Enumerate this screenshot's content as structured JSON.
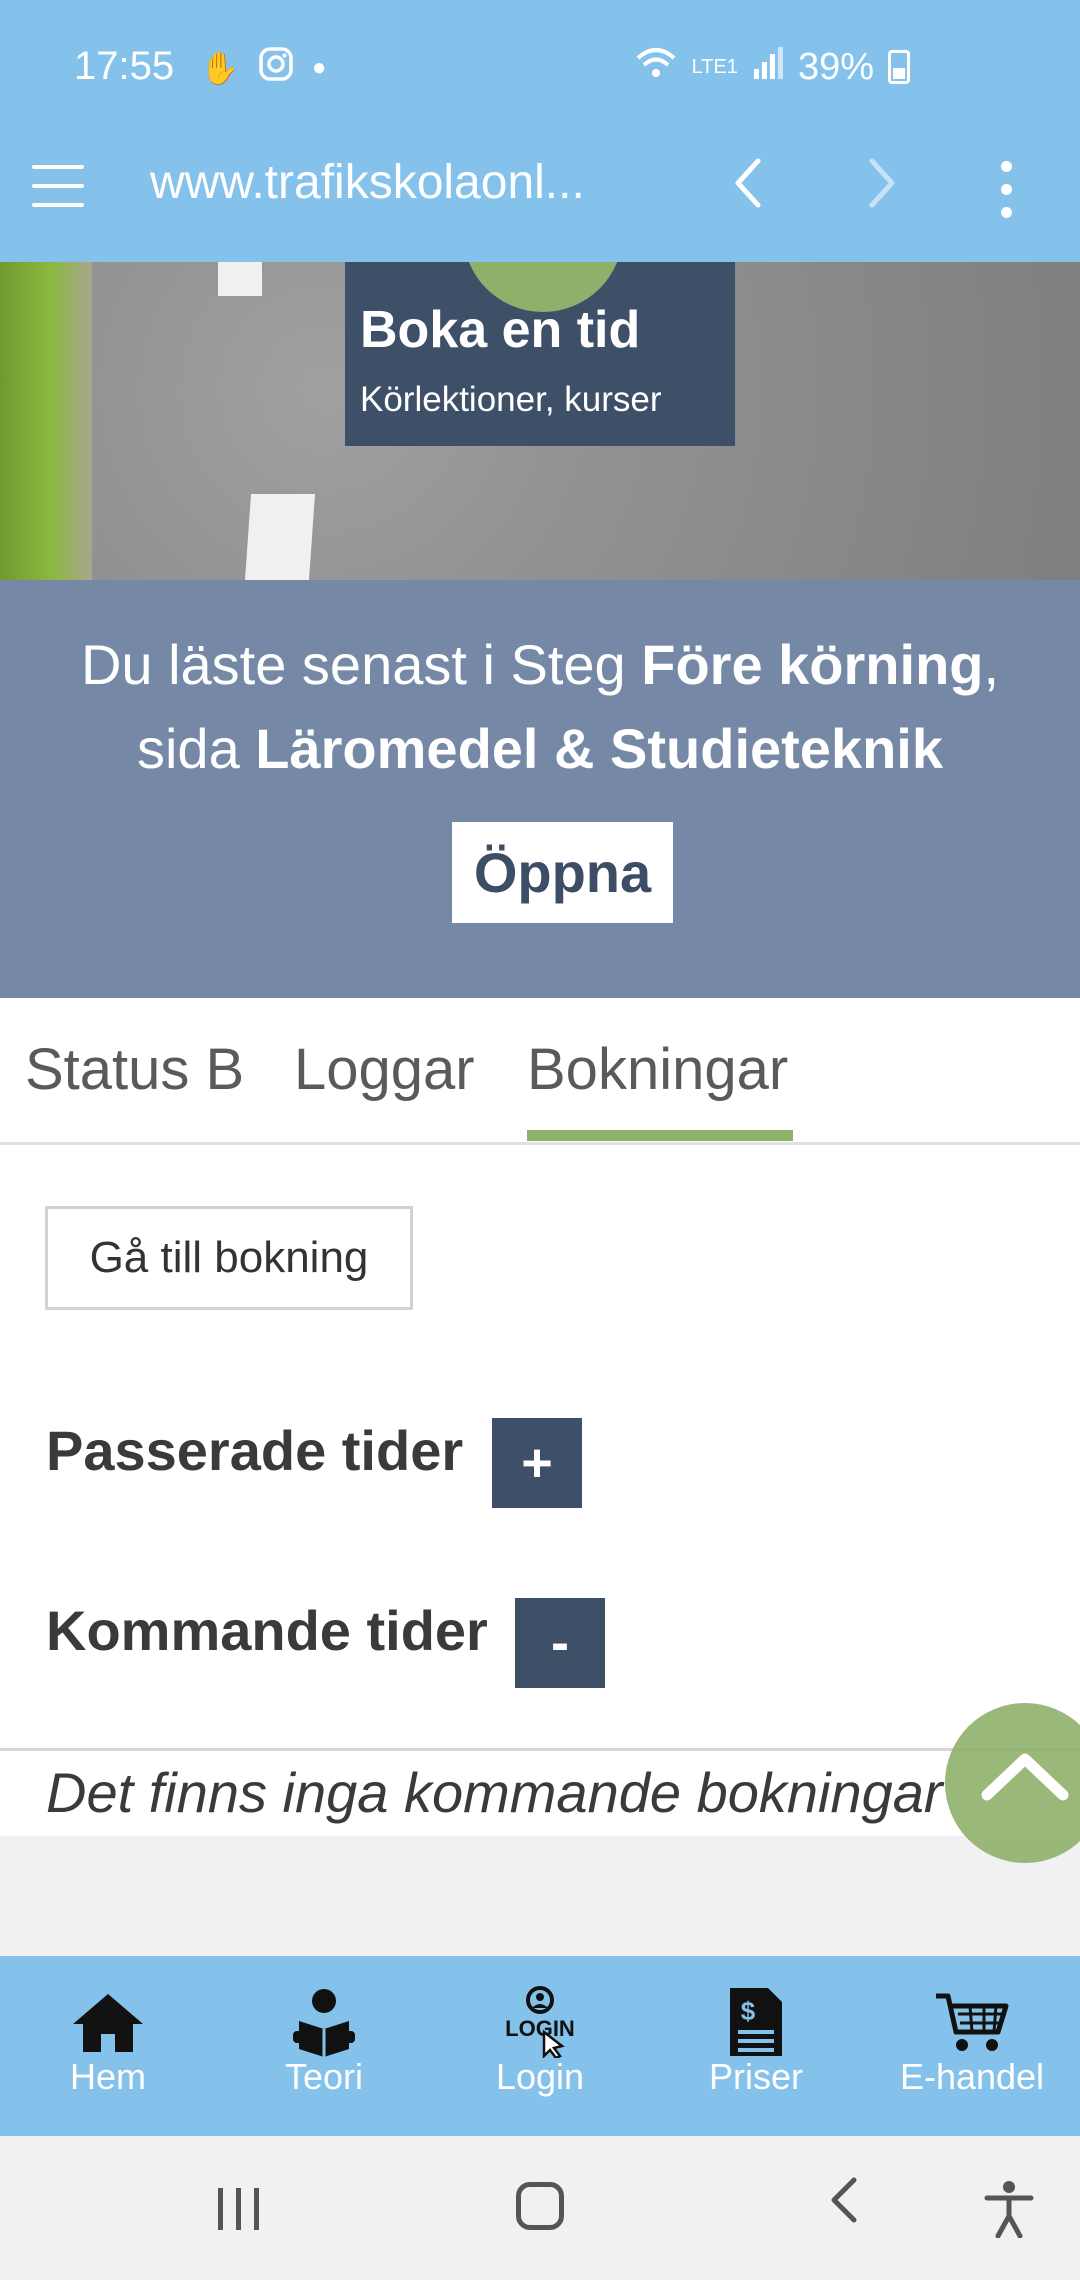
{
  "status_bar": {
    "time": "17:55",
    "battery": "39%",
    "network": "LTE1"
  },
  "browser": {
    "url": "www.trafikskolaonl...",
    "back_glyph": "‹",
    "forward_glyph": "›"
  },
  "hero": {
    "title": "Boka en tid",
    "subtitle": "Körlektioner, kurser"
  },
  "last_read": {
    "prefix": "Du läste senast i Steg ",
    "step": "Före körning",
    "comma": ",",
    "page_prefix": "sida ",
    "page": "Läromedel & Studieteknik",
    "open_label": "Öppna"
  },
  "tabs": [
    {
      "label": "Status B"
    },
    {
      "label": "Loggar"
    },
    {
      "label": "Bokningar"
    }
  ],
  "bookings": {
    "goto_label": "Gå till bokning",
    "past_title": "Passerade tider",
    "past_toggle": "+",
    "upcoming_title": "Kommande tider",
    "upcoming_toggle": "-",
    "empty_message": "Det finns inga kommande bokningar"
  },
  "bottom_nav": [
    {
      "label": "Hem",
      "icon": "home-icon"
    },
    {
      "label": "Teori",
      "icon": "reader-icon"
    },
    {
      "label": "Login",
      "icon": "login-icon"
    },
    {
      "label": "Priser",
      "icon": "price-document-icon"
    },
    {
      "label": "E-handel",
      "icon": "cart-icon"
    }
  ],
  "colors": {
    "header_blue": "#85c2eb",
    "dark_slate": "#3e5068",
    "slate_panel": "#7589a7",
    "accent_green": "#8fb06b"
  }
}
